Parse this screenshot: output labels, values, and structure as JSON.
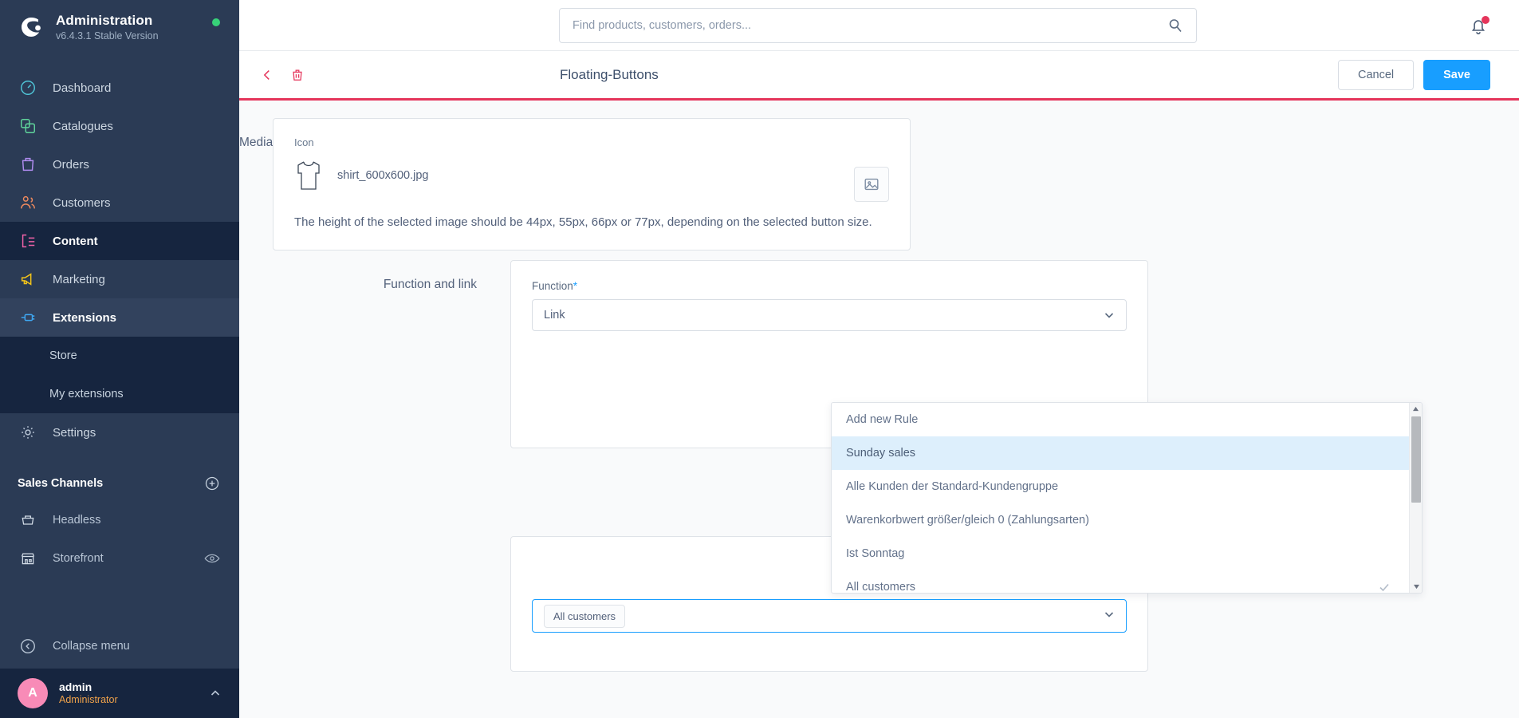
{
  "sidebar": {
    "brand": {
      "title": "Administration",
      "version": "v6.4.3.1 Stable Version",
      "status": "online"
    },
    "nav": [
      {
        "label": "Dashboard",
        "icon": "speedometer-icon",
        "color": "#4fc4d6",
        "state": "default"
      },
      {
        "label": "Catalogues",
        "icon": "layers-icon",
        "color": "#5fd39b",
        "state": "default"
      },
      {
        "label": "Orders",
        "icon": "bag-icon",
        "color": "#b08cf0",
        "state": "default"
      },
      {
        "label": "Customers",
        "icon": "people-icon",
        "color": "#f08a5d",
        "state": "default"
      },
      {
        "label": "Content",
        "icon": "content-icon",
        "color": "#f062a8",
        "state": "active"
      },
      {
        "label": "Marketing",
        "icon": "megaphone-icon",
        "color": "#f5c518",
        "state": "default"
      },
      {
        "label": "Extensions",
        "icon": "plug-icon",
        "color": "#3fa9f5",
        "state": "expanded"
      }
    ],
    "nav_sub": [
      {
        "label": "Store"
      },
      {
        "label": "My extensions"
      }
    ],
    "settings": {
      "label": "Settings",
      "icon": "gear-icon"
    },
    "sales_channels": {
      "heading": "Sales Channels",
      "add_icon": "plus-circle-icon",
      "items": [
        {
          "label": "Headless",
          "icon": "basket-icon",
          "trailing_icon": null
        },
        {
          "label": "Storefront",
          "icon": "storefront-icon",
          "trailing_icon": "eye-icon"
        }
      ]
    },
    "collapse": {
      "label": "Collapse menu",
      "icon": "chevron-left-circle-icon"
    },
    "user": {
      "initial": "A",
      "name": "admin",
      "role": "Administrator",
      "caret_icon": "chevron-up-icon"
    }
  },
  "topbar": {
    "search": {
      "value": "",
      "placeholder": "Find products, customers, orders...",
      "icon": "search-icon"
    },
    "notifications": {
      "icon": "bell-icon",
      "has_unread": true,
      "dot_color": "#e5355b"
    }
  },
  "pagehead": {
    "back_icon": "chevron-left-icon",
    "delete_icon": "trash-icon",
    "title": "Floating-Buttons",
    "cancel_label": "Cancel",
    "save_label": "Save",
    "accent_color": "#e5355b",
    "save_color": "#189eff"
  },
  "media": {
    "section_label": "Media",
    "field_label": "Icon",
    "file_name": "shirt_600x600.jpg",
    "thumb_icon": "shirt-icon",
    "hint": "The height of the selected image should be 44px, 55px, 66px or 77px, depending on the selected button size.",
    "upload_icon": "image-placeholder-icon"
  },
  "function_section": {
    "section_label": "Function and link",
    "field_label": "Function",
    "required_marker": "*",
    "selected_value": "Link",
    "chevron_icon": "chevron-down-icon"
  },
  "rule_section": {
    "selected_chip": "All customers",
    "chevron_icon": "chevron-down-icon"
  },
  "dropdown": {
    "open": true,
    "scroll_up_icon": "caret-up-icon",
    "scroll_down_icon": "caret-down-icon",
    "check_icon": "check-icon",
    "options": [
      {
        "label": "Add new Rule",
        "highlighted": false,
        "selected": false
      },
      {
        "label": "Sunday sales",
        "highlighted": true,
        "selected": false
      },
      {
        "label": "Alle Kunden der Standard-Kundengruppe",
        "highlighted": false,
        "selected": false
      },
      {
        "label": "Warenkorbwert größer/gleich 0 (Zahlungsarten)",
        "highlighted": false,
        "selected": false
      },
      {
        "label": "Ist Sonntag",
        "highlighted": false,
        "selected": false
      },
      {
        "label": "All customers",
        "highlighted": false,
        "selected": true
      }
    ]
  }
}
